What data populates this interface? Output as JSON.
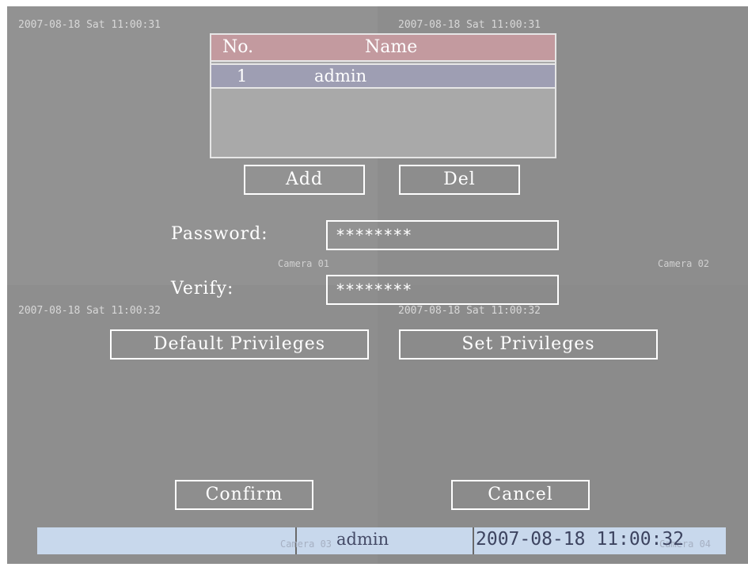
{
  "cameras": [
    {
      "timestamp": "2007-08-18 Sat 11:00:31",
      "label": "Camera 01"
    },
    {
      "timestamp": "2007-08-18 Sat 11:00:31",
      "label": "Camera 02"
    },
    {
      "timestamp": "2007-08-18 Sat 11:00:32",
      "label": "Camera 03"
    },
    {
      "timestamp": "2007-08-18 Sat 11:00:32",
      "label": "Camera 04"
    }
  ],
  "user_table": {
    "headers": {
      "no": "No.",
      "name": "Name"
    },
    "rows": [
      {
        "no": "1",
        "name": "admin"
      }
    ]
  },
  "buttons": {
    "add": "Add",
    "del": "Del",
    "default_privileges": "Default Privileges",
    "set_privileges": "Set Privileges",
    "confirm": "Confirm",
    "cancel": "Cancel"
  },
  "form": {
    "password_label": "Password:",
    "password_value": "********",
    "verify_label": "Verify:",
    "verify_value": "********"
  },
  "status_bar": {
    "user": "admin",
    "datetime": "2007-08-18 11:00:32"
  },
  "colors": {
    "header_row": "#c39a9f",
    "selected_row": "#9e9eb3",
    "status_bar": "#c8d8ec"
  }
}
